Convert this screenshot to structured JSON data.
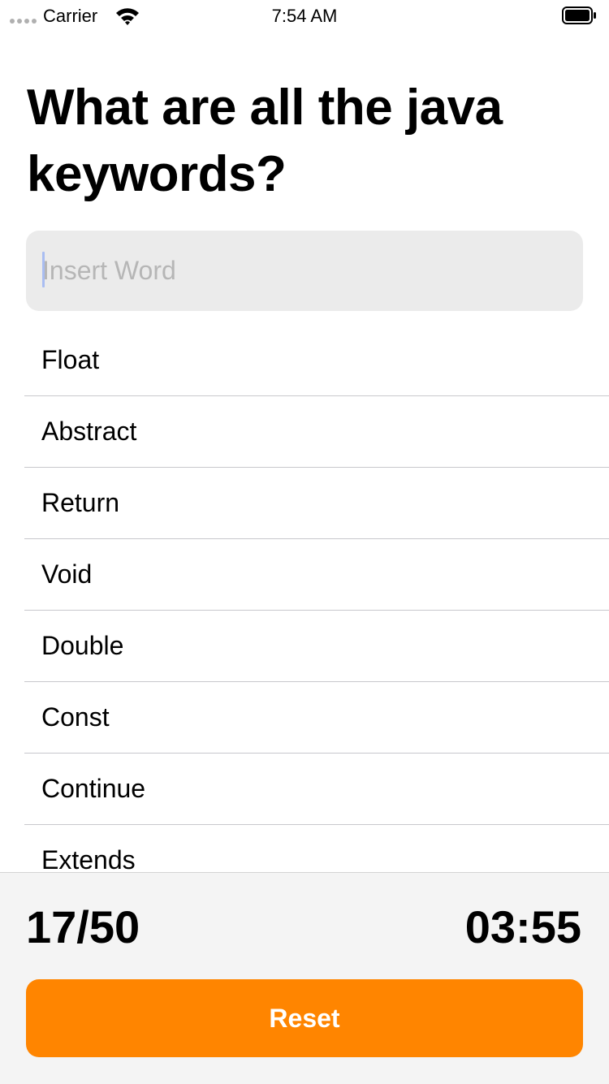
{
  "status_bar": {
    "carrier": "Carrier",
    "time": "7:54 AM",
    "signal_icon": "signal-dots-icon",
    "wifi_icon": "wifi-icon",
    "battery_icon": "battery-full-icon"
  },
  "question": {
    "title": "What are all the java keywords?"
  },
  "search": {
    "placeholder": "Insert Word",
    "value": ""
  },
  "words": [
    "Float",
    "Abstract",
    "Return",
    "Void",
    "Double",
    "Const",
    "Continue",
    "Extends"
  ],
  "footer": {
    "score": "17/50",
    "timer": "03:55",
    "reset_label": "Reset"
  },
  "colors": {
    "accent": "#ff8500",
    "input_background": "#ebebeb",
    "panel_background": "#f4f4f4"
  }
}
